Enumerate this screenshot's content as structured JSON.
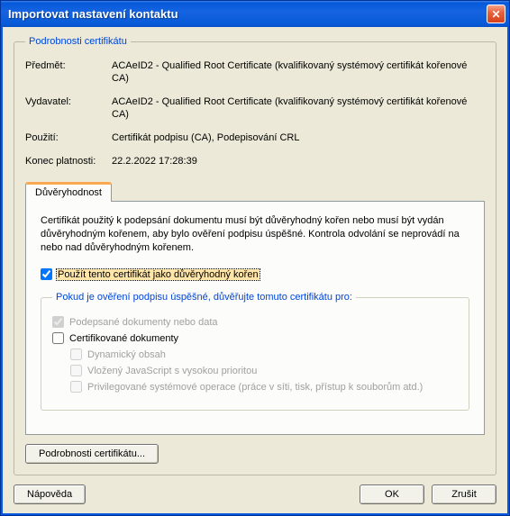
{
  "window": {
    "title": "Importovat nastavení kontaktu"
  },
  "details": {
    "legend": "Podrobnosti certifikátu",
    "subject_label": "Předmět:",
    "subject_value": "ACAeID2 - Qualified Root Certificate (kvalifikovaný systémový certifikát kořenové CA)",
    "issuer_label": "Vydavatel:",
    "issuer_value": "ACAeID2 - Qualified Root Certificate (kvalifikovaný systémový certifikát kořenové CA)",
    "usage_label": "Použití:",
    "usage_value": "Certifikát podpisu (CA), Podepisování CRL",
    "expiry_label": "Konec platnosti:",
    "expiry_value": "22.2.2022 17:28:39"
  },
  "tab": {
    "label": "Důvěryhodnost"
  },
  "trust": {
    "description": "Certifikát použitý k podepsání dokumentu musí být důvěryhodný kořen nebo musí být vydán důvěryhodným kořenem, aby bylo ověření podpisu úspěšné.  Kontrola odvolání se neprovádí na nebo nad důvěryhodným kořenem.",
    "root_checkbox": "Použít tento certifikát jako důvěryhodný kořen",
    "inner_legend": "Pokud je ověření podpisu úspěšné, důvěřujte tomuto certifikátu pro:",
    "signed_docs": "Podepsané dokumenty nebo data",
    "certified_docs": "Certifikované dokumenty",
    "dynamic_content": "Dynamický obsah",
    "embedded_js": "Vložený JavaScript s vysokou prioritou",
    "privileged_ops": "Privilegované systémové operace (práce v síti, tisk, přístup k souborům atd.)"
  },
  "buttons": {
    "cert_details": "Podrobnosti certifikátu...",
    "help": "Nápověda",
    "ok": "OK",
    "cancel": "Zrušit"
  }
}
